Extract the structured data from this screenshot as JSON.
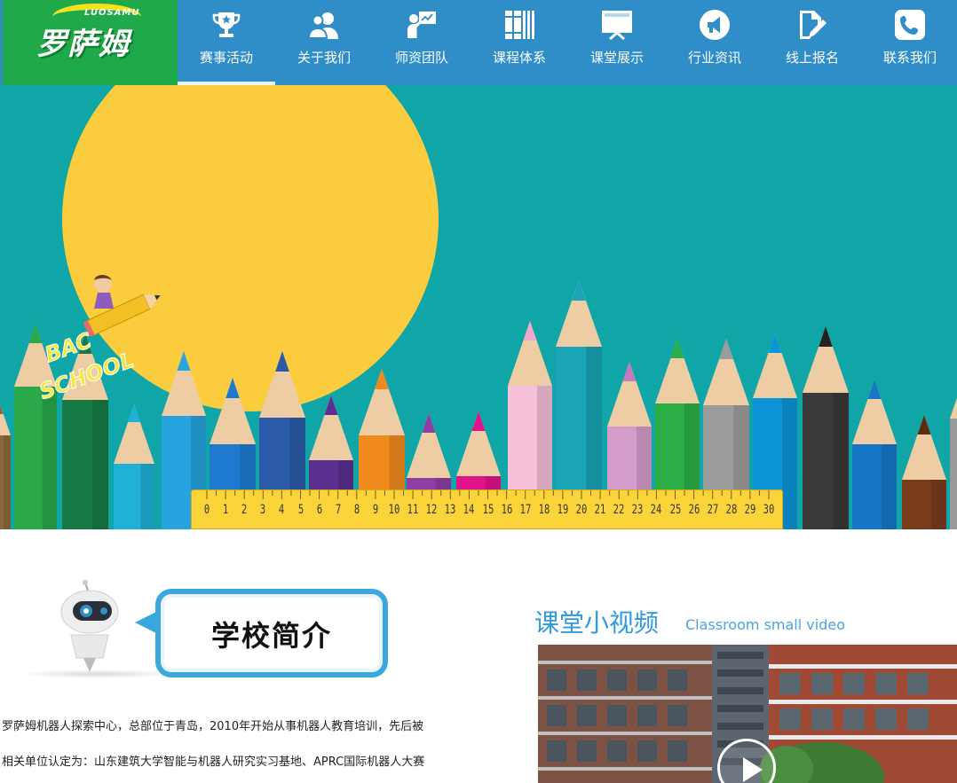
{
  "brand": {
    "logo_text": "罗萨姆",
    "logo_subtext": "LUOSAMU",
    "logo_bg": "#1fa94a",
    "header_bg": "#2f8ec8"
  },
  "nav": {
    "items": [
      {
        "label": "赛事活动",
        "icon": "trophy-icon"
      },
      {
        "label": "关于我们",
        "icon": "users-icon"
      },
      {
        "label": "师资团队",
        "icon": "teacher-icon"
      },
      {
        "label": "课程体系",
        "icon": "books-icon"
      },
      {
        "label": "课堂展示",
        "icon": "presentation-icon"
      },
      {
        "label": "行业资讯",
        "icon": "megaphone-icon"
      },
      {
        "label": "线上报名",
        "icon": "signup-pen-icon"
      },
      {
        "label": "联系我们",
        "icon": "phone-icon"
      }
    ],
    "active_index": 0
  },
  "banner": {
    "badge_text": [
      "BAC",
      "SCHOOL"
    ],
    "ruler_numbers": [
      "0",
      "1",
      "2",
      "3",
      "4",
      "5",
      "6",
      "7",
      "8",
      "9",
      "10",
      "11",
      "12",
      "13",
      "14",
      "15",
      "16",
      "17",
      "18",
      "19",
      "20",
      "21",
      "22",
      "23",
      "24",
      "25",
      "26",
      "27",
      "28",
      "29",
      "30"
    ],
    "bg_color": "#10a6a8",
    "sun_color": "#fbcc3d"
  },
  "intro": {
    "heading": "学校简介",
    "lines": [
      "罗萨姆机器人探索中心，总部位于青岛，2010年开始从事机器人教育培训，先后被",
      "相关单位认定为：山东建筑大学智能与机器人研究实习基地、APRC国际机器人大赛"
    ]
  },
  "video": {
    "title": "课堂小视频",
    "subtitle": "Classroom small video",
    "play_icon": "play-icon"
  }
}
